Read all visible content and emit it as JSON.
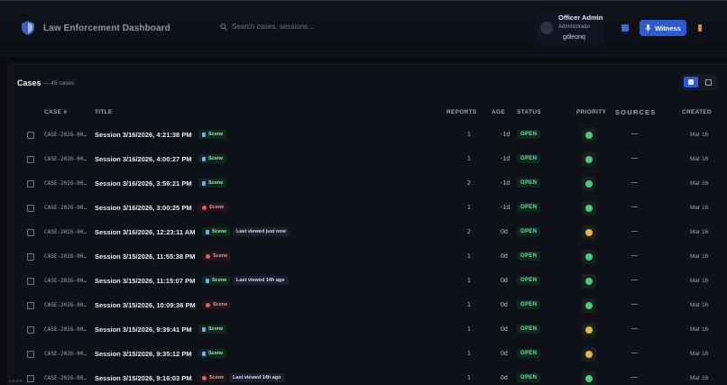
{
  "header": {
    "app_title": "Law Enforcement Dashboard",
    "search_placeholder": "Search cases, sessions...",
    "user": {
      "name": "Officer Admin",
      "role": "Administrator",
      "handle": "gdleonq"
    },
    "witness_label": "Witness"
  },
  "cases": {
    "title": "Cases",
    "count_label": "— 45 cases",
    "columns": {
      "case_num": "CASE #",
      "title": "TITLE",
      "reports": "REPORTS",
      "age": "AGE",
      "status": "STATUS",
      "priority": "PRIORITY",
      "sources": "SOURCES",
      "created": "CREATED"
    },
    "rows": [
      {
        "case_id": "CASE-2026-00…",
        "title": "Session 3/16/2026, 4:21:38 PM",
        "tag": "Scene",
        "tag_kind": "green",
        "viewed": "",
        "reports": "1",
        "age": "-1d",
        "status": "OPEN",
        "priority": "green",
        "sources": "—",
        "created": "Mar 16"
      },
      {
        "case_id": "CASE-2026-00…",
        "title": "Session 3/16/2026, 4:00:27 PM",
        "tag": "Scene",
        "tag_kind": "green",
        "viewed": "",
        "reports": "1",
        "age": "-1d",
        "status": "OPEN",
        "priority": "green",
        "sources": "—",
        "created": "Mar 16"
      },
      {
        "case_id": "CASE-2026-00…",
        "title": "Session 3/16/2026, 3:56:21 PM",
        "tag": "Scene",
        "tag_kind": "green",
        "viewed": "",
        "reports": "2",
        "age": "-1d",
        "status": "OPEN",
        "priority": "green",
        "sources": "—",
        "created": "Mar 16"
      },
      {
        "case_id": "CASE-2026-00…",
        "title": "Session 3/16/2026, 3:00:25 PM",
        "tag": "Scene",
        "tag_kind": "red",
        "viewed": "",
        "reports": "1",
        "age": "-1d",
        "status": "OPEN",
        "priority": "green",
        "sources": "—",
        "created": "Mar 16"
      },
      {
        "case_id": "CASE-2026-00…",
        "title": "Session 3/16/2026, 12:23:11 AM",
        "tag": "Scene",
        "tag_kind": "green",
        "viewed": "Last viewed just now",
        "reports": "2",
        "age": "0d",
        "status": "OPEN",
        "priority": "yellow",
        "sources": "—",
        "created": "Mar 16"
      },
      {
        "case_id": "CASE-2026-00…",
        "title": "Session 3/15/2026, 11:55:38 PM",
        "tag": "Scene",
        "tag_kind": "red",
        "viewed": "",
        "reports": "1",
        "age": "0d",
        "status": "OPEN",
        "priority": "green",
        "sources": "—",
        "created": "Mar 16"
      },
      {
        "case_id": "CASE-2026-00…",
        "title": "Session 3/15/2026, 11:15:07 PM",
        "tag": "Scene",
        "tag_kind": "green",
        "viewed": "Last viewed 14h ago",
        "reports": "1",
        "age": "0d",
        "status": "OPEN",
        "priority": "green",
        "sources": "—",
        "created": "Mar 16"
      },
      {
        "case_id": "CASE-2026-00…",
        "title": "Session 3/15/2026, 10:09:36 PM",
        "tag": "Scene",
        "tag_kind": "red",
        "viewed": "",
        "reports": "1",
        "age": "0d",
        "status": "OPEN",
        "priority": "green",
        "sources": "—",
        "created": "Mar 16"
      },
      {
        "case_id": "CASE-2026-00…",
        "title": "Session 3/15/2026, 9:39:41 PM",
        "tag": "Scene",
        "tag_kind": "green",
        "viewed": "",
        "reports": "1",
        "age": "0d",
        "status": "OPEN",
        "priority": "yellow",
        "sources": "—",
        "created": "Mar 16"
      },
      {
        "case_id": "CASE-2026-00…",
        "title": "Session 3/15/2026, 9:35:12 PM",
        "tag": "Scene",
        "tag_kind": "green",
        "viewed": "",
        "reports": "1",
        "age": "0d",
        "status": "OPEN",
        "priority": "yellow",
        "sources": "—",
        "created": "Mar 16"
      },
      {
        "case_id": "CASE-2026-00…",
        "title": "Session 3/15/2026, 9:16:03 PM",
        "tag": "Scene",
        "tag_kind": "red",
        "viewed": "Last viewed 14h ago",
        "reports": "1",
        "age": "0d",
        "status": "OPEN",
        "priority": "green",
        "sources": "—",
        "created": "Mar 16"
      }
    ]
  },
  "footer": {
    "corner_label": "v 0.474"
  },
  "colors": {
    "accent": "#2f5bd0",
    "status_open": "#5fe39b",
    "priority_green": "#4cc97a",
    "priority_yellow": "#e6b44a",
    "danger": "#e35d6a"
  }
}
